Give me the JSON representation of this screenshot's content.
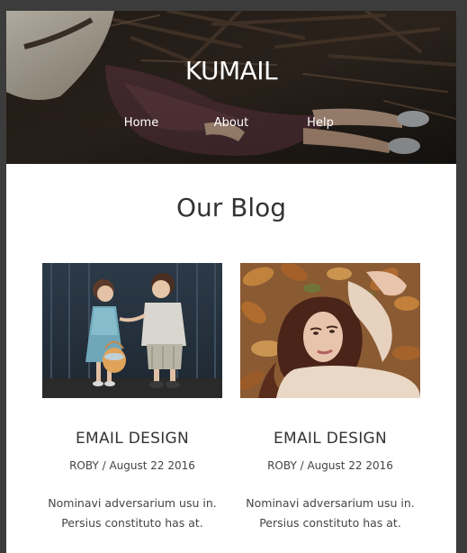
{
  "header": {
    "brand": "KUMAIL",
    "nav": [
      {
        "label": "Home"
      },
      {
        "label": "About"
      },
      {
        "label": "Help"
      }
    ]
  },
  "blog": {
    "title": "Our Blog",
    "posts": [
      {
        "title": "EMAIL DESIGN",
        "meta": "ROBY / August 22 2016",
        "excerpt_line1": "Nominavi adversarium usu in.",
        "excerpt_line2": "Persius constituto has at."
      },
      {
        "title": "EMAIL DESIGN",
        "meta": "ROBY / August 22 2016",
        "excerpt_line1": "Nominavi adversarium usu in.",
        "excerpt_line2": "Persius constituto has at."
      }
    ]
  },
  "colors": {
    "page_bg": "#3c3c3c",
    "content_bg": "#ffffff",
    "text_dark": "#333333",
    "nav_text": "#ffffff"
  }
}
